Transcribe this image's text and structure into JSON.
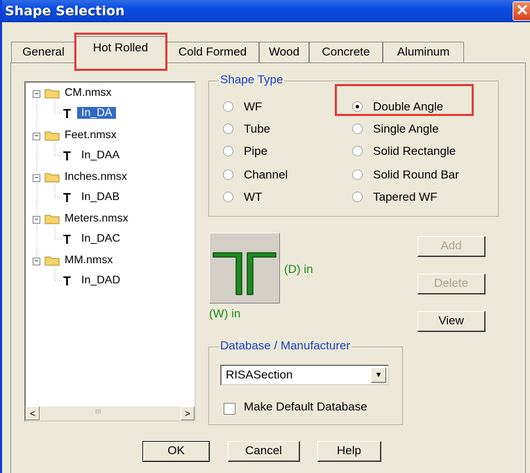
{
  "window": {
    "title": "Shape Selection",
    "close_glyph": "✕"
  },
  "tabs": [
    {
      "label": "General"
    },
    {
      "label": "Hot Rolled",
      "active": true
    },
    {
      "label": "Cold Formed"
    },
    {
      "label": "Wood"
    },
    {
      "label": "Concrete"
    },
    {
      "label": "Aluminum"
    }
  ],
  "tree": {
    "items": [
      {
        "label": "CM.nmsx",
        "type": "folder",
        "expanded": true
      },
      {
        "label": "In_DA",
        "type": "shape",
        "selected": true
      },
      {
        "label": "Feet.nmsx",
        "type": "folder",
        "expanded": true
      },
      {
        "label": "In_DAA",
        "type": "shape"
      },
      {
        "label": "Inches.nmsx",
        "type": "folder",
        "expanded": true
      },
      {
        "label": "In_DAB",
        "type": "shape"
      },
      {
        "label": "Meters.nmsx",
        "type": "folder",
        "expanded": true
      },
      {
        "label": "In_DAC",
        "type": "shape"
      },
      {
        "label": "MM.nmsx",
        "type": "folder",
        "expanded": true
      },
      {
        "label": "In_DAD",
        "type": "shape"
      }
    ],
    "scroll_left": "<",
    "scroll_right": ">",
    "scroll_thumb": "III"
  },
  "shape_type": {
    "title": "Shape Type",
    "options_left": [
      "WF",
      "Tube",
      "Pipe",
      "Channel",
      "WT"
    ],
    "options_right": [
      "Double Angle",
      "Single Angle",
      "Solid Rectangle",
      "Solid Round Bar",
      "Tapered WF"
    ],
    "selected": "Double Angle"
  },
  "preview": {
    "depth_label": "(D) in",
    "width_label": "(W) in",
    "line_color": "#1f8a1f"
  },
  "buttons": {
    "add": "Add",
    "delete": "Delete",
    "view": "View",
    "ok": "OK",
    "cancel": "Cancel",
    "help": "Help"
  },
  "database": {
    "title": "Database / Manufacturer",
    "selected": "RISASection",
    "dropdown_glyph": "▼",
    "make_default_label": "Make Default Database",
    "make_default_checked": false
  },
  "colors": {
    "title_bar": "#0a4be0",
    "highlight": "#e23b3b",
    "group_title": "#1a3dc4",
    "selection": "#316ac5"
  }
}
